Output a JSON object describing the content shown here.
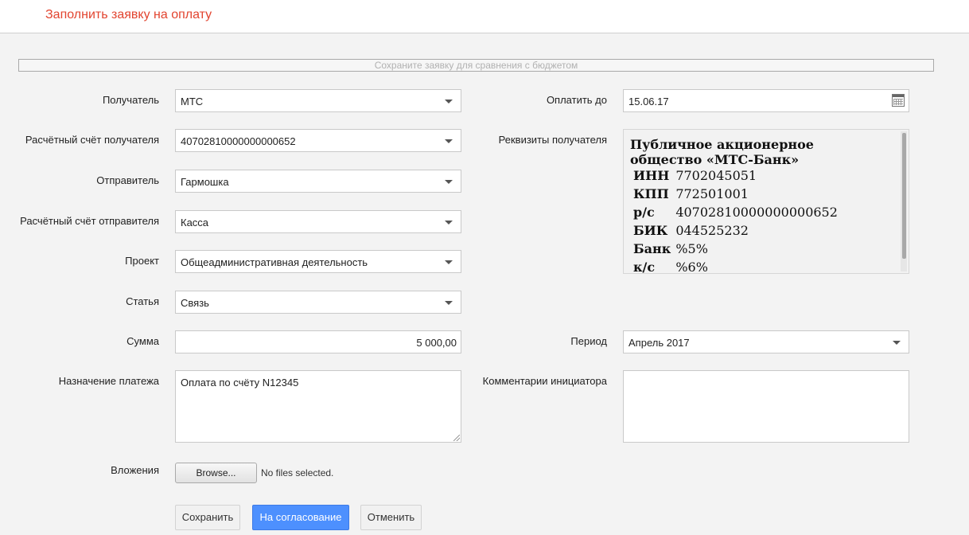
{
  "header": {
    "title": "Заполнить заявку на оплату"
  },
  "budget_bar": {
    "text": "Сохраните заявку для сравнения с бюджетом"
  },
  "form": {
    "recipient": {
      "label": "Получатель",
      "value": "МТС"
    },
    "recipient_account": {
      "label": "Расчётный счёт получателя",
      "value": "40702810000000000652"
    },
    "sender": {
      "label": "Отправитель",
      "value": "Гармошка"
    },
    "sender_account": {
      "label": "Расчётный счёт отправителя",
      "value": "Касса"
    },
    "project": {
      "label": "Проект",
      "value": "Общеадминистративная деятельность"
    },
    "article": {
      "label": "Статья",
      "value": "Связь"
    },
    "amount": {
      "label": "Сумма",
      "value": "5 000,00"
    },
    "purpose": {
      "label": "Назначение платежа",
      "value": "Оплата по счёту N12345"
    },
    "attachments": {
      "label": "Вложения",
      "browse_label": "Browse...",
      "status": "No files selected."
    },
    "pay_until": {
      "label": "Оплатить до",
      "value": "15.06.17",
      "icon": "calendar-icon"
    },
    "requisites": {
      "label": "Реквизиты получателя",
      "name_line1": "Публичное акционерное",
      "name_line2": "общество «МТС-Банк»",
      "rows": [
        {
          "key": "ИНН",
          "value": "7702045051"
        },
        {
          "key": "КПП",
          "value": "772501001"
        },
        {
          "key": "р/с",
          "value": "40702810000000000652"
        },
        {
          "key": "БИК",
          "value": "044525232"
        },
        {
          "key": "Банк",
          "value": "%5%"
        },
        {
          "key": "к/с",
          "value": "%6%"
        }
      ]
    },
    "period": {
      "label": "Период",
      "value": "Апрель 2017"
    },
    "initiator_comments": {
      "label": "Комментарии инициатора",
      "value": ""
    }
  },
  "actions": {
    "save": "Сохранить",
    "approve": "На согласование",
    "cancel": "Отменить"
  },
  "colors": {
    "title": "#e2442f",
    "primary_button": "#4d90fe",
    "background": "#f3f3f3"
  }
}
